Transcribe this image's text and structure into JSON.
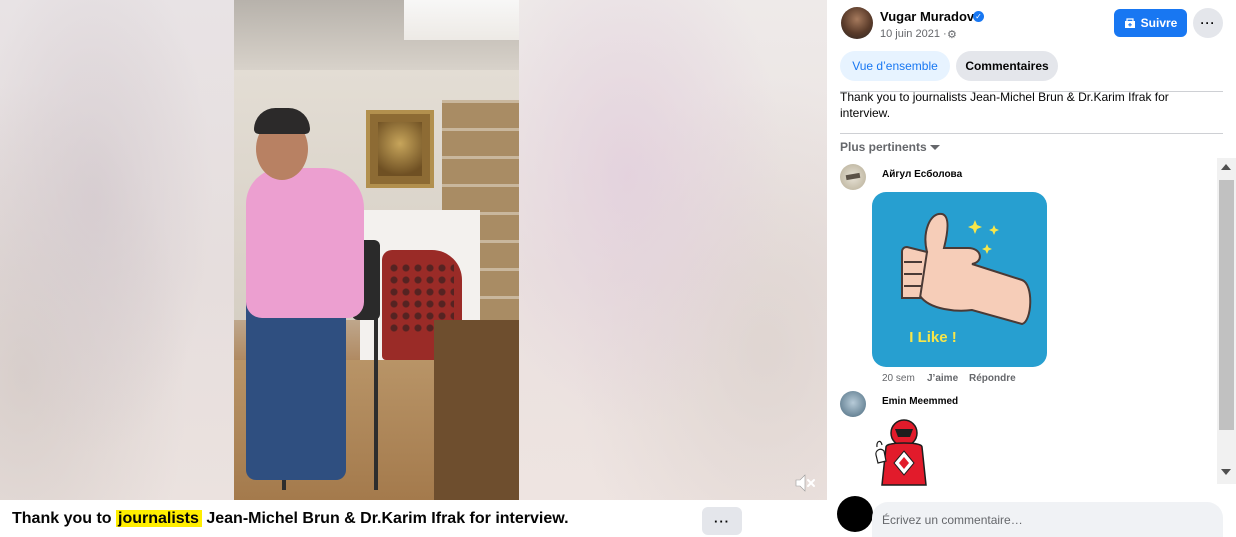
{
  "caption": {
    "before": "Thank you to ",
    "highlight": "journalists",
    "after": " Jean-Michel Brun & Dr.Karim Ifrak for interview.",
    "more": "···"
  },
  "author": {
    "name": "Vugar Muradov",
    "date": "10 juin 2021 ·",
    "follow_label": "Suivre",
    "options": "···"
  },
  "tabs": [
    {
      "label": "Vue d’ensemble"
    },
    {
      "label": "Commentaires"
    }
  ],
  "post_text": "Thank you to journalists Jean-Michel Brun & Dr.Karim Ifrak for interview.",
  "sort_label": "Plus pertinents",
  "comments": [
    {
      "author": "Айгул Есболова",
      "sticker_text": "I Like !",
      "time": "20 sem",
      "like": "J’aime",
      "reply": "Répondre"
    },
    {
      "author": "Emin Meemmed"
    }
  ],
  "composer": {
    "placeholder": "Écrivez un commentaire…"
  },
  "colors": {
    "accent": "#1877f2",
    "highlight": "#ffee00",
    "sticker_bg": "#279fd0",
    "sticker_text": "#f7e64a"
  }
}
